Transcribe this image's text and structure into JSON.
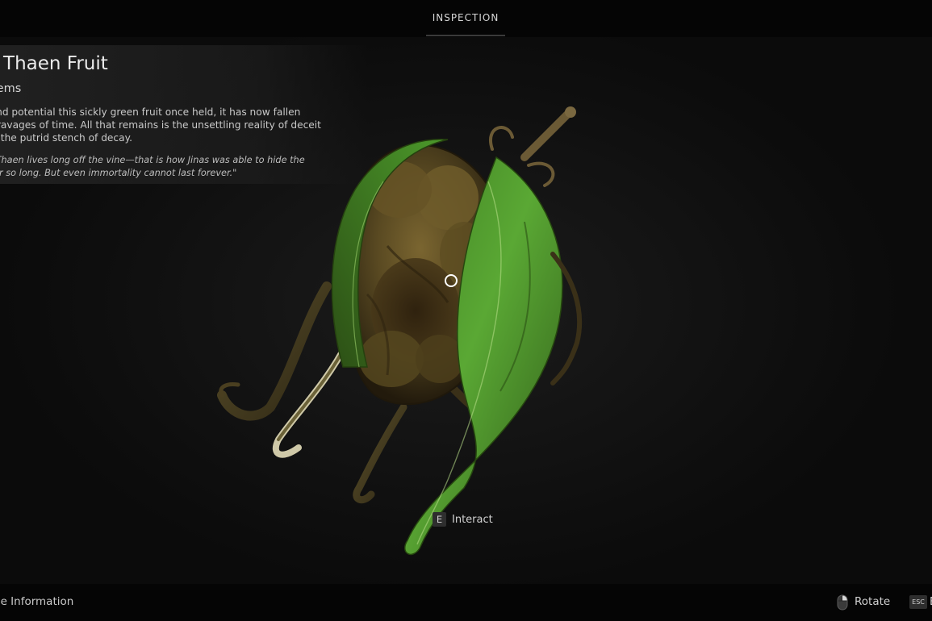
{
  "header": {
    "tab_label": "INSPECTION"
  },
  "item": {
    "title": "en Thaen Fruit",
    "category": "tems",
    "description_lines": [
      "r grand potential this sickly green fruit once held, it has now fallen",
      "the ravages of time. All that remains is the unsettling reality of deceit",
      "and the putrid stench of decay."
    ],
    "quote_lines": [
      "of the Thaen lives long off the vine—that is how Jinas was able to hide the",
      "ath for so long. But even immortality cannot last forever.\""
    ]
  },
  "prompt": {
    "key": "E",
    "label": "Interact"
  },
  "footer": {
    "hide_info_label": "de Information",
    "rotate_label": "Rotate",
    "esc_key": "ESC",
    "esc_label": "E"
  },
  "icons": {
    "fruit": "thaen-fruit-model",
    "reticle": "reticle-icon",
    "mouse": "mouse-icon"
  },
  "colors": {
    "background": "#0b0b0b",
    "bar": "#050505",
    "leaf_green": "#4d9a2c",
    "fruit_brown": "#5a4a22"
  }
}
